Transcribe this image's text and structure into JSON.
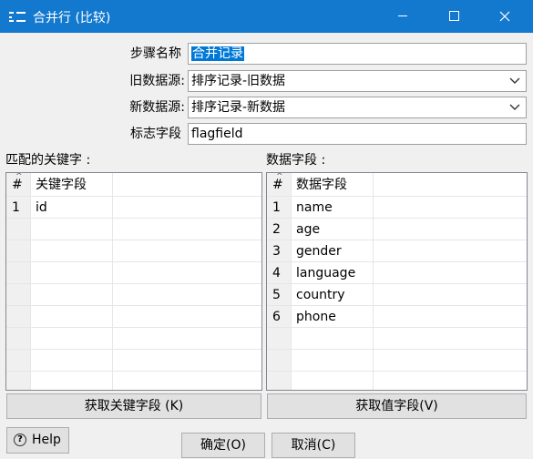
{
  "window": {
    "title": "合并行 (比较)"
  },
  "form": {
    "step_name_label": "步骤名称",
    "step_name_value": "合并记录",
    "old_source_label": "旧数据源:",
    "old_source_value": "排序记录-旧数据",
    "new_source_label": "新数据源:",
    "new_source_value": "排序记录-新数据",
    "flag_field_label": "标志字段",
    "flag_field_value": "flagfield"
  },
  "keys_table": {
    "section_label": "匹配的关键字 :",
    "col_index": "#",
    "col_name": "关键字段",
    "rows": [
      {
        "index": "1",
        "value": "id"
      }
    ]
  },
  "values_table": {
    "section_label": "数据字段 :",
    "col_index": "#",
    "col_name": "数据字段",
    "rows": [
      {
        "index": "1",
        "value": "name"
      },
      {
        "index": "2",
        "value": "age"
      },
      {
        "index": "3",
        "value": "gender"
      },
      {
        "index": "4",
        "value": "language"
      },
      {
        "index": "5",
        "value": "country"
      },
      {
        "index": "6",
        "value": "phone"
      }
    ]
  },
  "buttons": {
    "get_keys": "获取关键字段 (K)",
    "get_values": "获取值字段(V)",
    "help": "Help",
    "ok": "确定(O)",
    "cancel": "取消(C)"
  },
  "colors": {
    "titlebar": "#1379cf",
    "selection": "#0078d7"
  }
}
